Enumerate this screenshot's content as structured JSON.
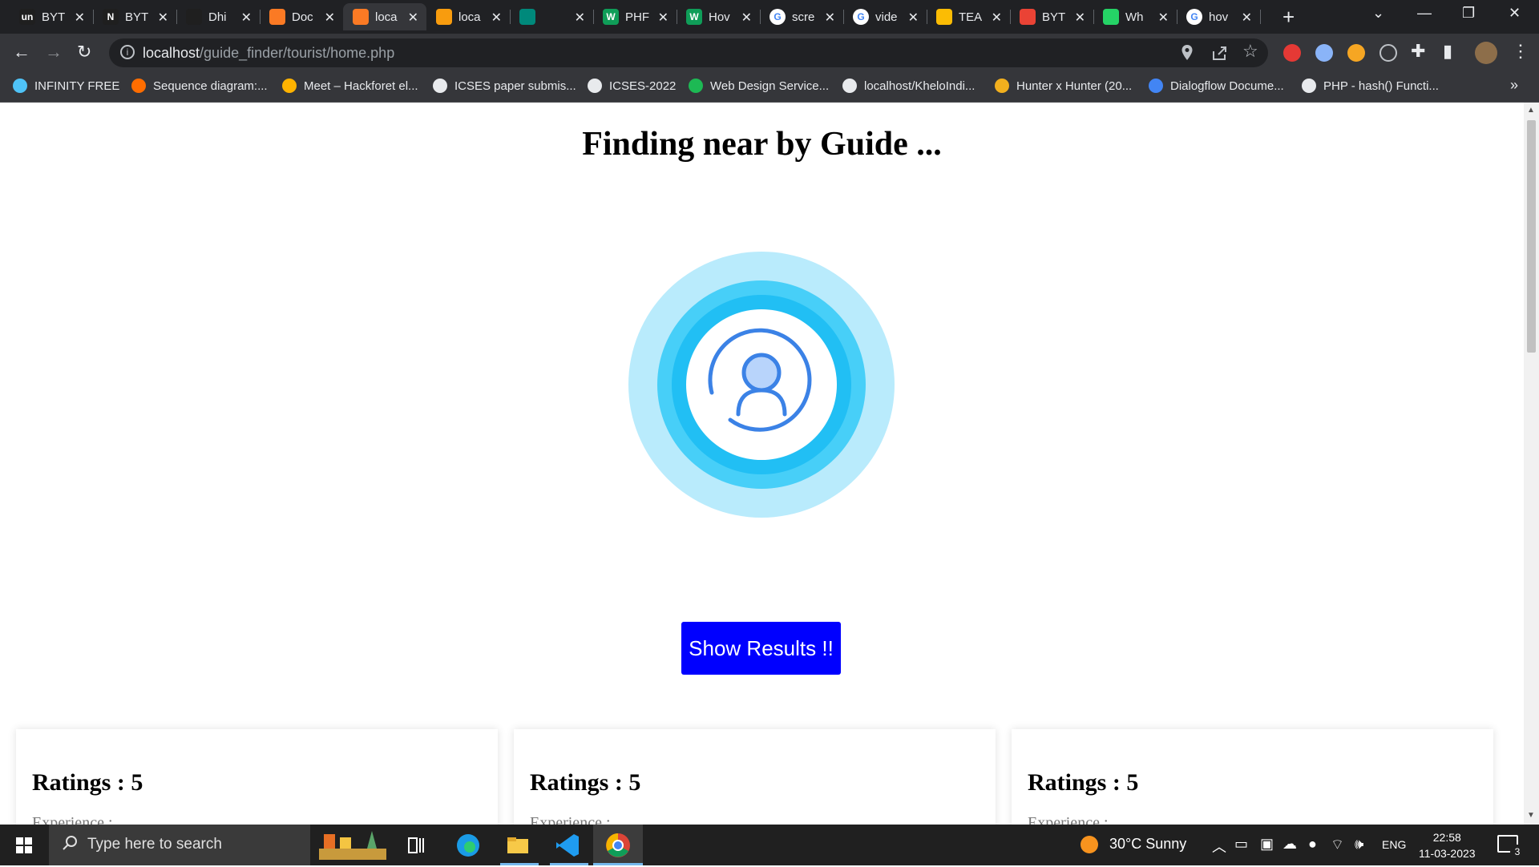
{
  "browser": {
    "tabs": [
      {
        "label": "BYT",
        "favicon": "un",
        "color": "#1f1f1f"
      },
      {
        "label": "BYT",
        "favicon": "N",
        "color": "#1f1f1f"
      },
      {
        "label": "Dhi",
        "favicon": "github-icon",
        "color": "#1f1f1f"
      },
      {
        "label": "Doc",
        "favicon": "xampp-icon",
        "color": "#fb7a24"
      },
      {
        "label": "loca",
        "favicon": "xampp-icon",
        "color": "#fb7a24",
        "active": true
      },
      {
        "label": "loca",
        "favicon": "pma-icon",
        "color": "#f89c0e"
      },
      {
        "label": "",
        "favicon": "meet-icon",
        "color": "#00897b"
      },
      {
        "label": "PHF",
        "favicon": "W",
        "color": "#0f9d58"
      },
      {
        "label": "Hov",
        "favicon": "W",
        "color": "#0f9d58"
      },
      {
        "label": "scre",
        "favicon": "google-icon",
        "color": "#ffffff"
      },
      {
        "label": "vide",
        "favicon": "google-icon",
        "color": "#ffffff"
      },
      {
        "label": "TEA",
        "favicon": "drive-icon",
        "color": "#fbbc04"
      },
      {
        "label": "BYT",
        "favicon": "gmail-icon",
        "color": "#ea4335"
      },
      {
        "label": "Wh",
        "favicon": "whatsapp-icon",
        "color": "#25d366"
      },
      {
        "label": "hov",
        "favicon": "google-icon",
        "color": "#ffffff"
      }
    ],
    "address": {
      "host": "localhost",
      "path": "/guide_finder/tourist/home.php"
    },
    "bookmarks": [
      {
        "label": "INFINITY FREE",
        "color": "#4fc3f7"
      },
      {
        "label": "Sequence diagram:...",
        "color": "#ff6d00"
      },
      {
        "label": "Meet – Hackforet el...",
        "color": "#ffb300"
      },
      {
        "label": "ICSES paper submis...",
        "color": "#e8eaed"
      },
      {
        "label": "ICSES-2022",
        "color": "#e8eaed"
      },
      {
        "label": "Web Design Service...",
        "color": "#1db954"
      },
      {
        "label": "localhost/KheloIndi...",
        "color": "#e8eaed"
      },
      {
        "label": "Hunter x Hunter (20...",
        "color": "#f2b01e"
      },
      {
        "label": "Dialogflow Docume...",
        "color": "#4285f4"
      },
      {
        "label": "PHP - hash() Functi...",
        "color": "#e8eaed"
      }
    ],
    "bookmarks_more": "»"
  },
  "page": {
    "heading": "Finding near by Guide ...",
    "show_button": "Show Results !!",
    "cards": [
      {
        "title": "Ratings : 5",
        "sub": "Experience :"
      },
      {
        "title": "Ratings : 5",
        "sub": "Experience :"
      },
      {
        "title": "Ratings : 5",
        "sub": "Experience :"
      }
    ],
    "colors": {
      "button": "#0000ff",
      "ring_outer": "#b9ebfc",
      "ring_mid": "#47cff8",
      "ring_inner": "#21bff4",
      "user_icon": "#3b82e6"
    }
  },
  "taskbar": {
    "search_placeholder": "Type here to search",
    "weather": "30°C  Sunny",
    "lang": "ENG",
    "time": "22:58",
    "date": "11-03-2023",
    "notifications": "3"
  }
}
